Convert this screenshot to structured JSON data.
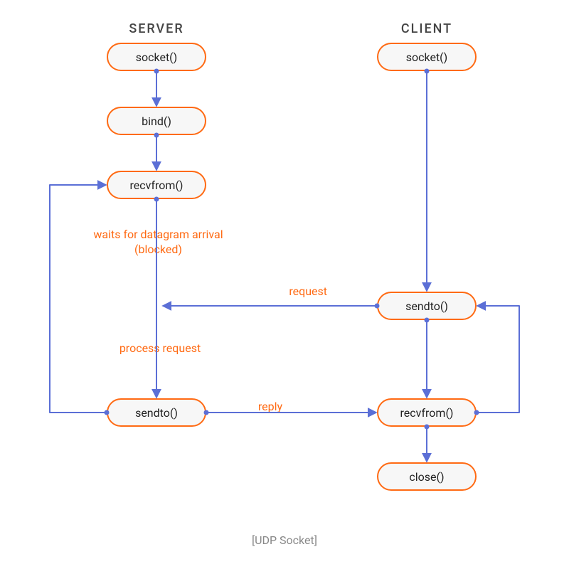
{
  "titles": {
    "server": "SERVER",
    "client": "CLIENT"
  },
  "server_nodes": {
    "socket": "socket()",
    "bind": "bind()",
    "recvfrom": "recvfrom()",
    "sendto": "sendto()"
  },
  "client_nodes": {
    "socket": "socket()",
    "sendto": "sendto()",
    "recvfrom": "recvfrom()",
    "close": "close()"
  },
  "annotations": {
    "waits_line1": "waits for datagram arrival",
    "waits_line2": "(blocked)",
    "process": "process request",
    "request": "request",
    "reply": "reply"
  },
  "caption": "[UDP Socket]",
  "colors": {
    "node_border": "#ff6a13",
    "node_fill": "#f7f7f7",
    "arrow": "#5b6fd6",
    "dot": "#5b6fd6",
    "annot": "#ff6a13"
  }
}
